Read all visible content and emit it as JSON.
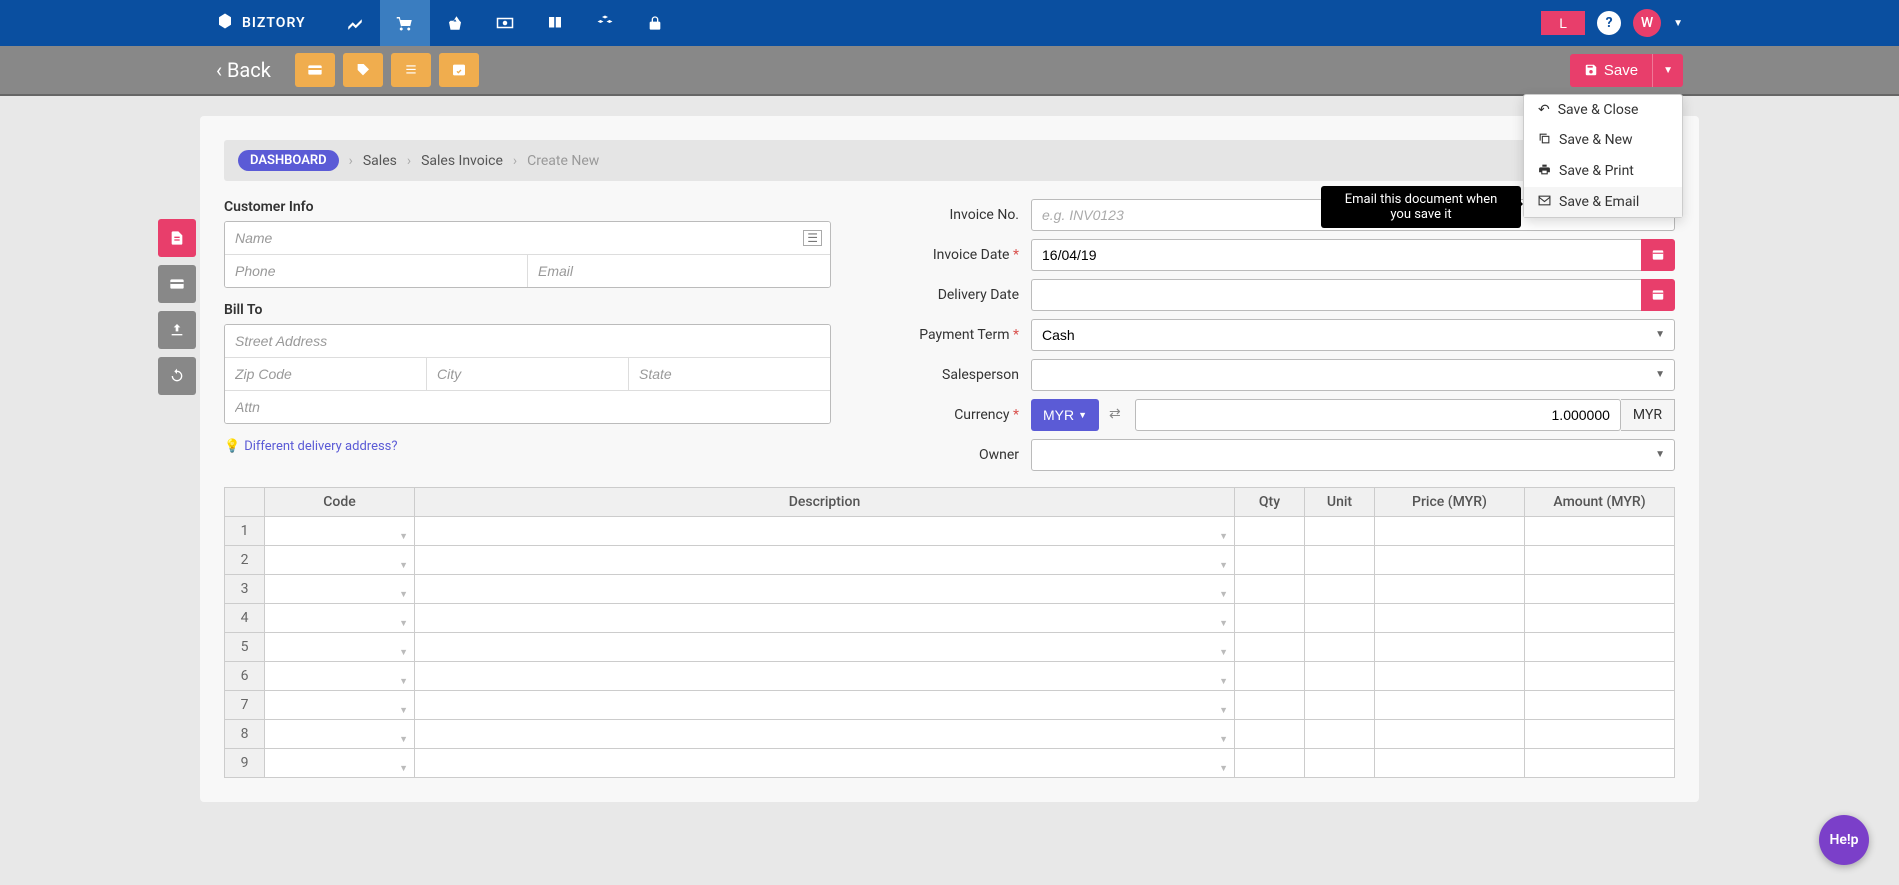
{
  "brand": "BIZTORY",
  "topbar": {
    "subscribe": "L",
    "avatar": "W"
  },
  "actionbar": {
    "back": "Back",
    "save": "Save",
    "dropdown": {
      "save_close": "Save & Close",
      "save_new": "Save & New",
      "save_print": "Save & Print",
      "save_email": "Save & Email"
    }
  },
  "tooltip": "Email this document when you save it",
  "breadcrumb": {
    "dashboard": "DASHBOARD",
    "sales": "Sales",
    "sales_invoice": "Sales Invoice",
    "create": "Create New"
  },
  "sections": {
    "customer_info": "Customer Info",
    "bill_to": "Bill To",
    "diff_delivery": "Different delivery address?"
  },
  "placeholders": {
    "name": "Name",
    "phone": "Phone",
    "email": "Email",
    "street": "Street Address",
    "zip": "Zip Code",
    "city": "City",
    "state": "State",
    "attn": "Attn",
    "invoice_no": "e.g. INV0123"
  },
  "right_labels": {
    "invoice_no": "Invoice No.",
    "invoice_date": "Invoice Date",
    "delivery_date": "Delivery Date",
    "payment_term": "Payment Term",
    "salesperson": "Salesperson",
    "currency": "Currency",
    "owner": "Owner"
  },
  "right_values": {
    "invoice_date": "16/04/19",
    "payment_term": "Cash",
    "currency_btn": "MYR",
    "currency_rate": "1.000000",
    "currency_code": "MYR"
  },
  "grid": {
    "cols": {
      "code": "Code",
      "desc": "Description",
      "qty": "Qty",
      "unit": "Unit",
      "price": "Price (MYR)",
      "amount": "Amount (MYR)"
    },
    "rows": [
      "1",
      "2",
      "3",
      "4",
      "5",
      "6",
      "7",
      "8",
      "9"
    ]
  },
  "help_bubble": "He!p"
}
